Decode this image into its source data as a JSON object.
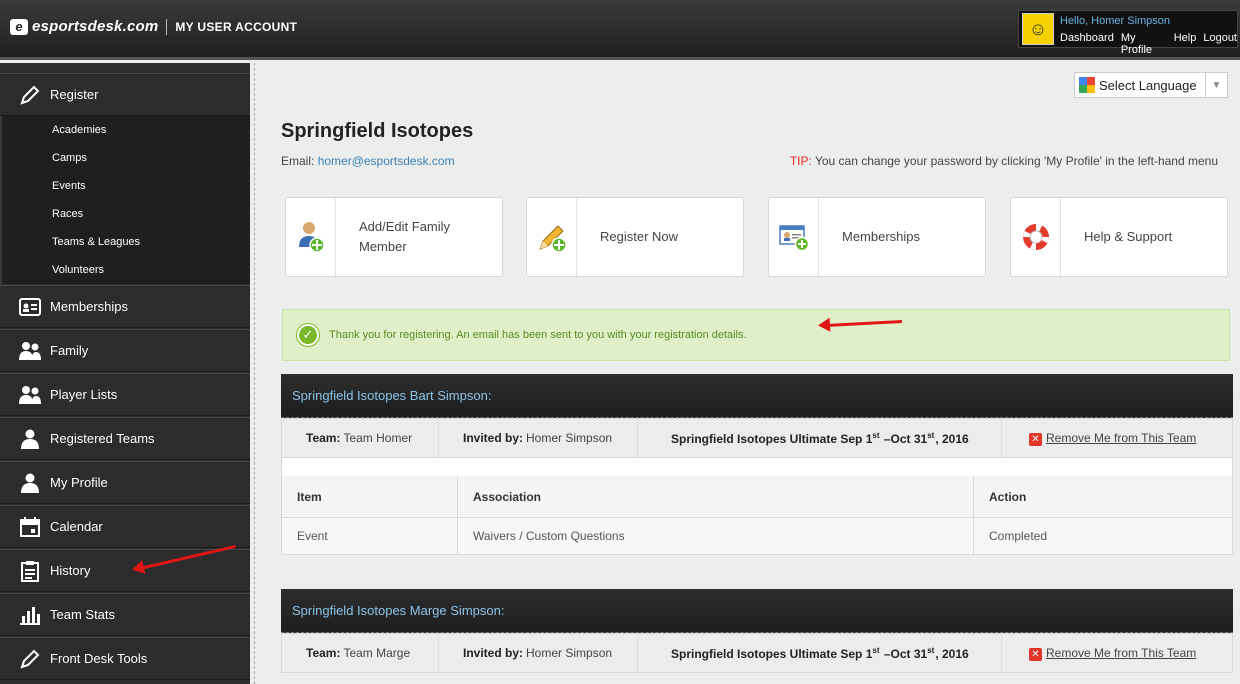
{
  "header": {
    "logo_text": "esportsdesk.com",
    "logo_mark": "e",
    "section_title": "MY USER ACCOUNT",
    "greeting": "Hello, Homer Simpson",
    "links": [
      "Dashboard",
      "My Profile",
      "Help",
      "Logout"
    ]
  },
  "sidebar": {
    "register_label": "Register",
    "register_sub": [
      "Academies",
      "Camps",
      "Events",
      "Races",
      "Teams & Leagues",
      "Volunteers"
    ],
    "items": [
      {
        "label": "Memberships",
        "icon": "id-card-icon"
      },
      {
        "label": "Family",
        "icon": "family-icon"
      },
      {
        "label": "Player Lists",
        "icon": "players-icon"
      },
      {
        "label": "Registered Teams",
        "icon": "user-icon"
      },
      {
        "label": "My Profile",
        "icon": "user-icon"
      },
      {
        "label": "Calendar",
        "icon": "calendar-icon"
      },
      {
        "label": "History",
        "icon": "clipboard-icon"
      },
      {
        "label": "Team Stats",
        "icon": "bar-chart-icon"
      },
      {
        "label": "Front Desk Tools",
        "icon": "pencil-icon"
      }
    ]
  },
  "language": {
    "label": "Select Language"
  },
  "main": {
    "org_name": "Springfield Isotopes",
    "email_label": "Email:",
    "email_value": "homer@esportsdesk.com",
    "tip_label": "TIP:",
    "tip_text": " You can change your password by clicking 'My Profile' in the left-hand menu",
    "tiles": [
      {
        "label": "Add/Edit Family Member",
        "icon": "add-family-member-icon"
      },
      {
        "label": "Register Now",
        "icon": "register-pencil-icon"
      },
      {
        "label": "Memberships",
        "icon": "membership-card-icon"
      },
      {
        "label": "Help & Support",
        "icon": "lifebuoy-icon"
      }
    ],
    "alert": "Thank you for registering. An email has been sent to you with your registration details."
  },
  "registrations": [
    {
      "title": "Springfield Isotopes Bart Simpson:",
      "team_label": "Team:",
      "team_value": "Team Homer",
      "invited_label": "Invited by:",
      "invited_value": "Homer Simpson",
      "event_name": "Springfield Isotopes Ultimate Sep 1",
      "event_sup1": "st",
      "event_mid": " –Oct 31",
      "event_sup2": "st",
      "event_year": ", 2016",
      "remove_label": "Remove Me from This Team",
      "table_headers": [
        "Item",
        "Association",
        "Action"
      ],
      "rows": [
        [
          "Event",
          "Waivers / Custom Questions",
          "Completed"
        ]
      ]
    },
    {
      "title": "Springfield Isotopes Marge Simpson:",
      "team_label": "Team:",
      "team_value": "Team Marge",
      "invited_label": "Invited by:",
      "invited_value": "Homer Simpson",
      "event_name": "Springfield Isotopes Ultimate Sep 1",
      "event_sup1": "st",
      "event_mid": " –Oct 31",
      "event_sup2": "st",
      "event_year": ", 2016",
      "remove_label": "Remove Me from This Team"
    }
  ],
  "colors": {
    "accent_link": "#3d7fb1",
    "tip_red": "#e8281c",
    "success_green": "#7ab829",
    "annotation_arrow": "#e01515"
  }
}
